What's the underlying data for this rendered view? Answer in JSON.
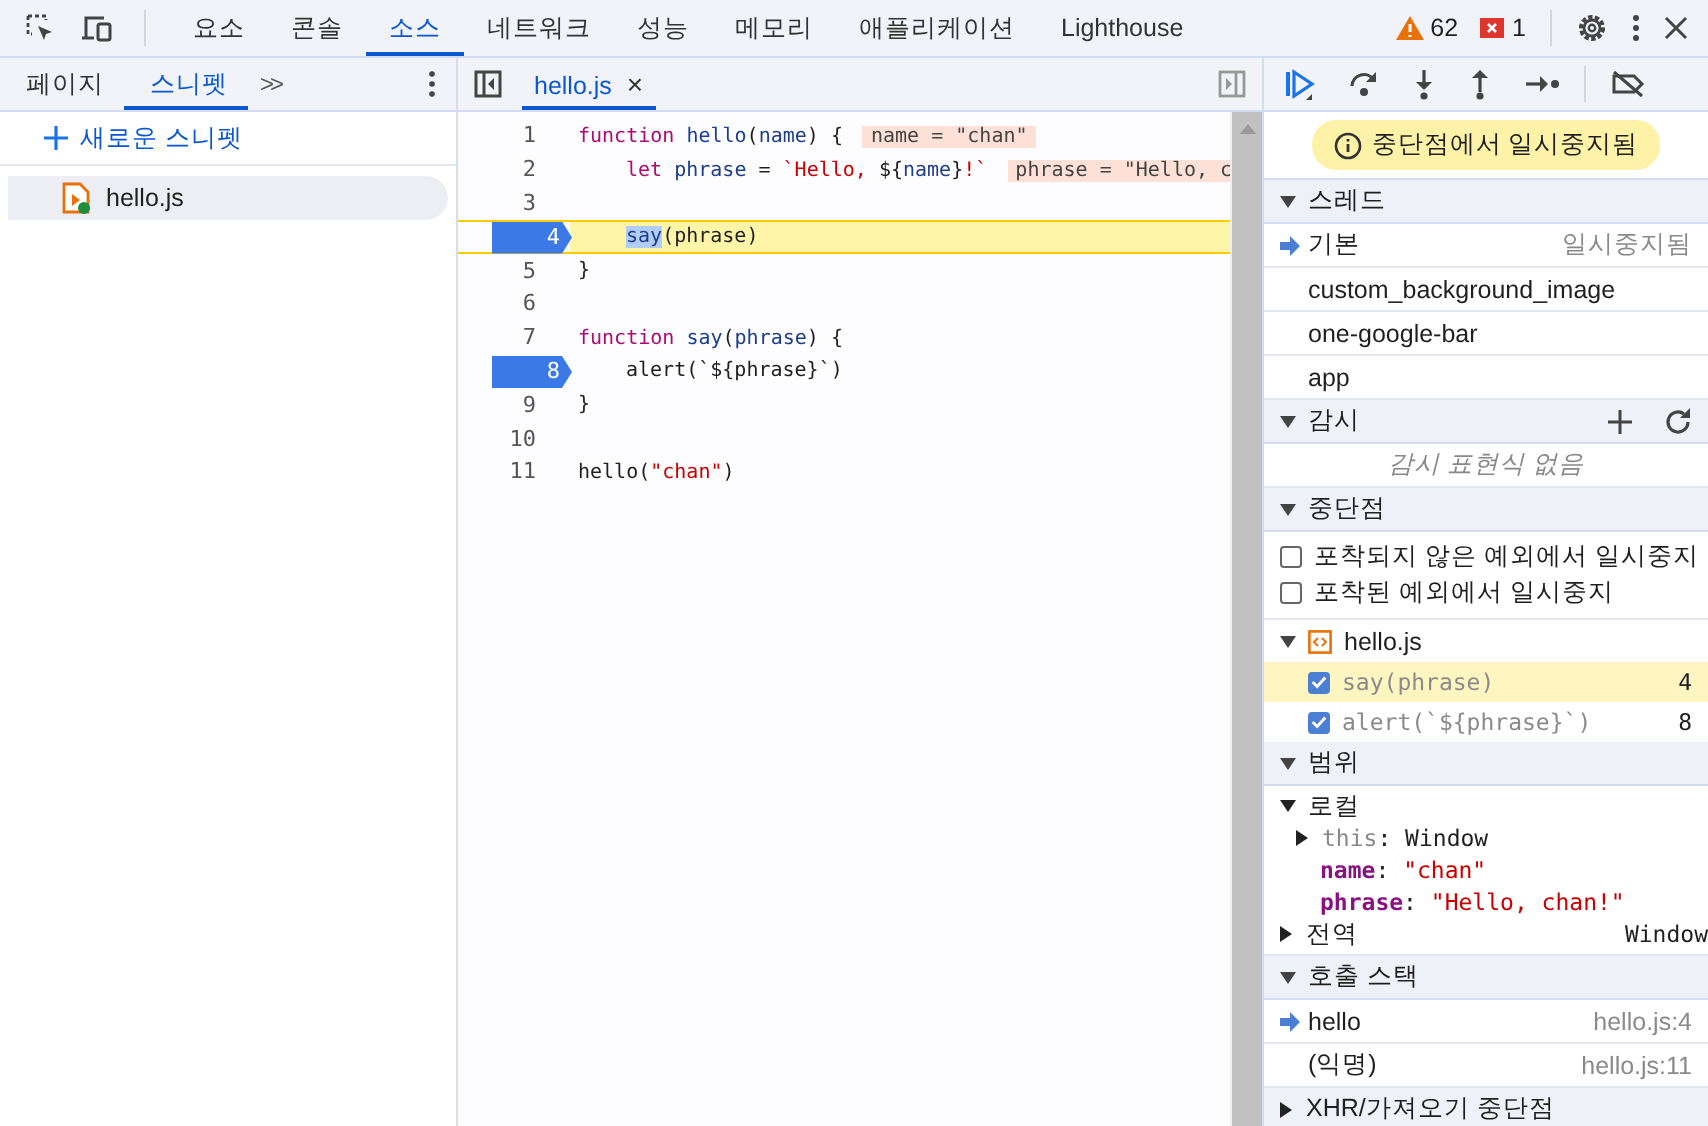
{
  "main_tabs": [
    {
      "label": "요소",
      "selected": false
    },
    {
      "label": "콘솔",
      "selected": false
    },
    {
      "label": "소스",
      "selected": true
    },
    {
      "label": "네트워크",
      "selected": false
    },
    {
      "label": "성능",
      "selected": false
    },
    {
      "label": "메모리",
      "selected": false
    },
    {
      "label": "애플리케이션",
      "selected": false
    },
    {
      "label": "Lighthouse",
      "selected": false
    }
  ],
  "warnings": "62",
  "errors": "1",
  "navigator": {
    "tabs": [
      {
        "label": "페이지",
        "selected": false
      },
      {
        "label": "스니펫",
        "selected": true
      }
    ],
    "more": ">>",
    "new_snippet": "새로운 스니펫",
    "files": [
      {
        "name": "hello.js",
        "selected": true
      }
    ]
  },
  "editor": {
    "tabs": [
      {
        "label": "hello.js",
        "selected": true,
        "close": "×"
      }
    ],
    "lines": [
      {
        "number": "1",
        "breakpoint": false,
        "current": false,
        "indent": false,
        "tokens": [
          {
            "kind": "kw",
            "text": "function "
          },
          {
            "kind": "def",
            "text": "hello"
          },
          {
            "kind": "plain",
            "text": "("
          },
          {
            "kind": "var",
            "text": "name"
          },
          {
            "kind": "plain",
            "text": ") {"
          }
        ],
        "inline_value": "name = \"chan\""
      },
      {
        "number": "2",
        "breakpoint": false,
        "current": false,
        "indent": true,
        "tokens": [
          {
            "kind": "kw",
            "text": "let "
          },
          {
            "kind": "var",
            "text": "phrase"
          },
          {
            "kind": "plain",
            "text": " = "
          },
          {
            "kind": "str",
            "text": "`Hello, "
          },
          {
            "kind": "plain",
            "text": "${"
          },
          {
            "kind": "var",
            "text": "name"
          },
          {
            "kind": "plain",
            "text": "}"
          },
          {
            "kind": "str",
            "text": "!`"
          }
        ],
        "inline_value": "phrase = \"Hello, c"
      },
      {
        "number": "3",
        "breakpoint": false,
        "current": false
      },
      {
        "number": "4",
        "breakpoint": true,
        "current": true,
        "indent": true,
        "tokens": [
          {
            "kind": "sel",
            "text": "say"
          },
          {
            "kind": "plain",
            "text": "(phrase)"
          }
        ]
      },
      {
        "number": "5",
        "breakpoint": false,
        "current": false,
        "indent": false,
        "tokens": [
          {
            "kind": "plain",
            "text": "}"
          }
        ]
      },
      {
        "number": "6",
        "breakpoint": false,
        "current": false
      },
      {
        "number": "7",
        "breakpoint": false,
        "current": false,
        "indent": false,
        "tokens": [
          {
            "kind": "kw",
            "text": "function "
          },
          {
            "kind": "def",
            "text": "say"
          },
          {
            "kind": "plain",
            "text": "("
          },
          {
            "kind": "var",
            "text": "phrase"
          },
          {
            "kind": "plain",
            "text": ") {"
          }
        ]
      },
      {
        "number": "8",
        "breakpoint": true,
        "current": false,
        "indent": true,
        "tokens": [
          {
            "kind": "plain",
            "text": "alert(`${phrase}`)"
          }
        ]
      },
      {
        "number": "9",
        "breakpoint": false,
        "current": false,
        "indent": false,
        "tokens": [
          {
            "kind": "plain",
            "text": "}"
          }
        ]
      },
      {
        "number": "10",
        "breakpoint": false,
        "current": false
      },
      {
        "number": "11",
        "breakpoint": false,
        "current": false,
        "indent": false,
        "tokens": [
          {
            "kind": "plain",
            "text": "hello("
          },
          {
            "kind": "str",
            "text": "\"chan\""
          },
          {
            "kind": "plain",
            "text": ")"
          }
        ]
      }
    ]
  },
  "debugger": {
    "paused_banner": "중단점에서 일시중지됨",
    "threads": {
      "title": "스레드",
      "expanded": true,
      "items": [
        {
          "name": "기본",
          "status": "일시중지됨",
          "current": true
        },
        {
          "name": "custom_background_image",
          "current": false
        },
        {
          "name": "one-google-bar",
          "current": false
        },
        {
          "name": "app",
          "current": false
        }
      ]
    },
    "watch": {
      "title": "감시",
      "expanded": true,
      "empty": "감시 표현식 없음"
    },
    "breakpoints": {
      "title": "중단점",
      "expanded": true,
      "options": [
        {
          "label": "포착되지 않은 예외에서 일시중지",
          "checked": false
        },
        {
          "label": "포착된 예외에서 일시중지",
          "checked": false
        }
      ],
      "file": {
        "name": "hello.js",
        "expanded": true
      },
      "items": [
        {
          "code": "say(phrase)",
          "line": "4",
          "checked": true,
          "hit": true
        },
        {
          "code": "alert(`${phrase}`)",
          "line": "8",
          "checked": true,
          "hit": false
        }
      ]
    },
    "scope": {
      "title": "범위",
      "expanded": true,
      "groups": [
        {
          "name": "로컬",
          "expanded": true,
          "children": [
            {
              "kind": "object",
              "name": "this",
              "separator": ":",
              "value": "Window",
              "expanded": false
            },
            {
              "kind": "string",
              "name": "name",
              "separator": ":",
              "value": "\"chan\""
            },
            {
              "kind": "string",
              "name": "phrase",
              "separator": ":",
              "value": "\"Hello, chan!\""
            }
          ]
        },
        {
          "name": "전역",
          "expanded": false,
          "value": "Window"
        }
      ]
    },
    "call_stack": {
      "title": "호출 스택",
      "expanded": true,
      "frames": [
        {
          "name": "hello",
          "location": "hello.js:4",
          "current": true
        },
        {
          "name": "(익명)",
          "location": "hello.js:11",
          "current": false
        }
      ]
    },
    "xhr": {
      "title": "XHR/가져오기 중단점",
      "expanded": false
    }
  }
}
